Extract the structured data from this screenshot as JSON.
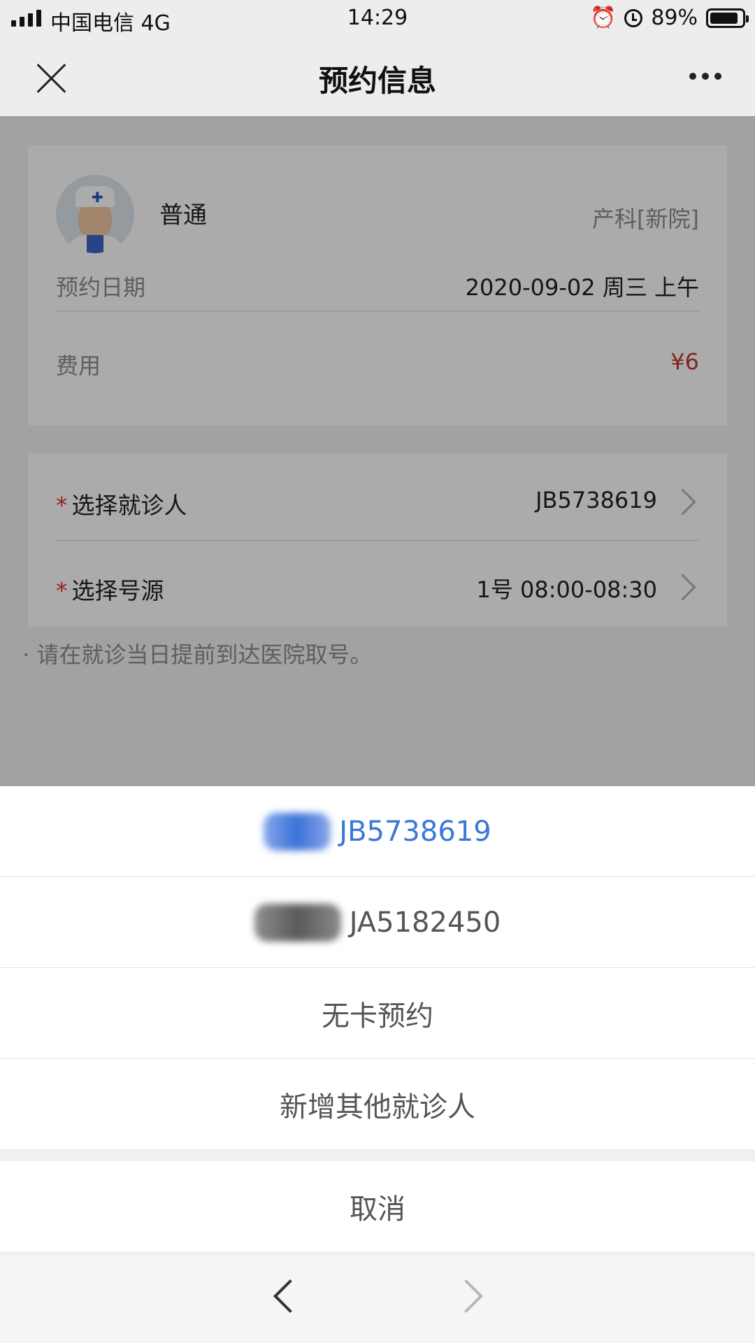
{
  "status_bar": {
    "carrier": "中国电信 4G",
    "time": "14:29",
    "battery": "89%",
    "battery_level": 0.89
  },
  "nav": {
    "title": "预约信息"
  },
  "doctor": {
    "name": "普通",
    "department": "产科[新院]"
  },
  "appointment": {
    "date_label": "预约日期",
    "date_value": "2020-09-02 周三 上午",
    "fee_label": "费用",
    "fee_value": "¥6"
  },
  "selection": {
    "required_mark": "*",
    "patient_label": "选择就诊人",
    "patient_value": "JB5738619",
    "source_label": "选择号源",
    "source_value": "1号 08:00-08:30"
  },
  "tip": "· 请在就诊当日提前到达医院取号。",
  "action_sheet": {
    "options": [
      {
        "label": "JB5738619"
      },
      {
        "label": "JA5182450"
      },
      {
        "label": "无卡预约"
      },
      {
        "label": "新增其他就诊人"
      }
    ],
    "cancel": "取消"
  },
  "icons": {
    "close": "close-icon",
    "more": "more-icon",
    "back": "back-arrow-icon",
    "forward": "forward-arrow-icon"
  }
}
